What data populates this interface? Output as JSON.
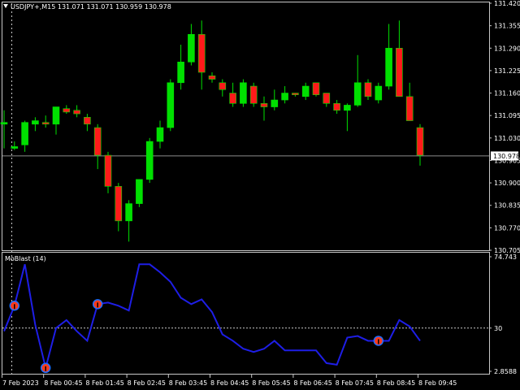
{
  "window": {
    "header": "USDJPY+,M15  131.071 131.071 130.959 130.978",
    "indicator_title": "MoBlast (14)",
    "current_price_label": "130.978"
  },
  "colors": {
    "background": "#000000",
    "frame": "#c8c8c8",
    "bull": "#00e000",
    "bear": "#ff1a1a",
    "wick": "#00e000",
    "indicator_line": "#1e1ee6",
    "marker_fill": "#ff3a1a",
    "marker_ring": "#1e6eff",
    "price_line": "#8c8c8c",
    "dotted": "#c8c8c8"
  },
  "icons": {
    "menu": "triangle-down-icon"
  },
  "chart_data": [
    {
      "type": "candlestick",
      "title": "USDJPY+,M15",
      "ylim": [
        130.705,
        131.42
      ],
      "yticks": [
        "131.420",
        "131.355",
        "131.290",
        "131.225",
        "131.160",
        "131.095",
        "131.030",
        "130.965",
        "130.900",
        "130.835",
        "130.770",
        "130.705"
      ],
      "last_price": 130.978,
      "candles": [
        {
          "o": 131.07,
          "h": 131.11,
          "l": 131.0,
          "c": 131.075
        },
        {
          "o": 131.0,
          "h": 131.02,
          "l": 130.995,
          "c": 131.005
        },
        {
          "o": 131.01,
          "h": 131.08,
          "l": 130.99,
          "c": 131.075
        },
        {
          "o": 131.07,
          "h": 131.09,
          "l": 131.05,
          "c": 131.08
        },
        {
          "o": 131.075,
          "h": 131.095,
          "l": 131.06,
          "c": 131.07
        },
        {
          "o": 131.07,
          "h": 131.12,
          "l": 131.04,
          "c": 131.12
        },
        {
          "o": 131.115,
          "h": 131.125,
          "l": 131.1,
          "c": 131.105
        },
        {
          "o": 131.11,
          "h": 131.125,
          "l": 131.09,
          "c": 131.1
        },
        {
          "o": 131.09,
          "h": 131.1,
          "l": 131.05,
          "c": 131.07
        },
        {
          "o": 131.06,
          "h": 131.07,
          "l": 130.94,
          "c": 130.98
        },
        {
          "o": 130.98,
          "h": 130.99,
          "l": 130.87,
          "c": 130.89
        },
        {
          "o": 130.89,
          "h": 130.9,
          "l": 130.76,
          "c": 130.79
        },
        {
          "o": 130.79,
          "h": 130.85,
          "l": 130.73,
          "c": 130.84
        },
        {
          "o": 130.84,
          "h": 130.91,
          "l": 130.83,
          "c": 130.91
        },
        {
          "o": 130.91,
          "h": 131.03,
          "l": 130.9,
          "c": 131.02
        },
        {
          "o": 131.02,
          "h": 131.08,
          "l": 131.0,
          "c": 131.06
        },
        {
          "o": 131.06,
          "h": 131.2,
          "l": 131.05,
          "c": 131.19
        },
        {
          "o": 131.19,
          "h": 131.3,
          "l": 131.17,
          "c": 131.25
        },
        {
          "o": 131.25,
          "h": 131.36,
          "l": 131.24,
          "c": 131.33
        },
        {
          "o": 131.33,
          "h": 131.37,
          "l": 131.17,
          "c": 131.22
        },
        {
          "o": 131.21,
          "h": 131.22,
          "l": 131.19,
          "c": 131.2
        },
        {
          "o": 131.19,
          "h": 131.2,
          "l": 131.15,
          "c": 131.17
        },
        {
          "o": 131.16,
          "h": 131.19,
          "l": 131.12,
          "c": 131.13
        },
        {
          "o": 131.13,
          "h": 131.2,
          "l": 131.12,
          "c": 131.19
        },
        {
          "o": 131.18,
          "h": 131.19,
          "l": 131.12,
          "c": 131.13
        },
        {
          "o": 131.13,
          "h": 131.15,
          "l": 131.08,
          "c": 131.12
        },
        {
          "o": 131.12,
          "h": 131.17,
          "l": 131.11,
          "c": 131.14
        },
        {
          "o": 131.14,
          "h": 131.18,
          "l": 131.13,
          "c": 131.16
        },
        {
          "o": 131.16,
          "h": 131.16,
          "l": 131.15,
          "c": 131.155
        },
        {
          "o": 131.15,
          "h": 131.19,
          "l": 131.14,
          "c": 131.18
        },
        {
          "o": 131.19,
          "h": 131.19,
          "l": 131.15,
          "c": 131.155
        },
        {
          "o": 131.16,
          "h": 131.16,
          "l": 131.12,
          "c": 131.13
        },
        {
          "o": 131.13,
          "h": 131.14,
          "l": 131.1,
          "c": 131.11
        },
        {
          "o": 131.11,
          "h": 131.13,
          "l": 131.05,
          "c": 131.125
        },
        {
          "o": 131.125,
          "h": 131.27,
          "l": 131.12,
          "c": 131.19
        },
        {
          "o": 131.19,
          "h": 131.2,
          "l": 131.14,
          "c": 131.15
        },
        {
          "o": 131.14,
          "h": 131.19,
          "l": 131.13,
          "c": 131.18
        },
        {
          "o": 131.18,
          "h": 131.36,
          "l": 131.17,
          "c": 131.29
        },
        {
          "o": 131.29,
          "h": 131.37,
          "l": 131.2,
          "c": 131.15
        },
        {
          "o": 131.15,
          "h": 131.19,
          "l": 131.1,
          "c": 131.08
        },
        {
          "o": 131.06,
          "h": 131.07,
          "l": 130.95,
          "c": 130.98
        }
      ]
    },
    {
      "type": "line",
      "title": "MoBlast (14)",
      "ylim": [
        2.8588,
        74.743
      ],
      "yticks": [
        "74.743",
        "30",
        "2.8588"
      ],
      "level": 30,
      "x_labels": [
        "7 Feb 2023",
        "8 Feb 00:45",
        "8 Feb 01:45",
        "8 Feb 02:45",
        "8 Feb 03:45",
        "8 Feb 04:45",
        "8 Feb 05:45",
        "8 Feb 06:45",
        "8 Feb 07:45",
        "8 Feb 08:45",
        "8 Feb 09:45"
      ],
      "values": [
        28,
        44,
        70,
        32,
        5,
        30,
        35,
        28,
        22,
        45,
        46,
        44,
        41,
        70,
        70,
        65,
        59,
        49,
        45,
        48,
        40,
        26,
        22,
        17,
        15,
        17,
        22,
        16,
        16,
        16,
        16,
        8,
        7,
        24,
        25,
        22,
        22,
        22,
        35,
        31,
        22
      ],
      "signals": [
        1,
        4,
        9,
        36
      ]
    }
  ]
}
